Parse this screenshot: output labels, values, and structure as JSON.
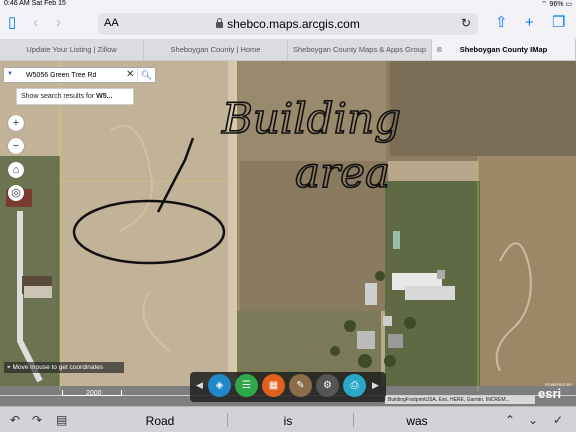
{
  "status": {
    "time": "0:46 AM",
    "date": "Sat Feb 15",
    "battery": "96%"
  },
  "browser": {
    "aa": "AA",
    "url": "shebco.maps.arcgis.com",
    "tabs": [
      {
        "label": "Update Your Listing | Zillow"
      },
      {
        "label": "Sheboygan County | Home"
      },
      {
        "label": "Sheboygan County Maps & Apps Group"
      },
      {
        "label": "Sheboygan County IMap"
      }
    ],
    "icons": [
      "sidebar-icon",
      "back-icon",
      "forward-icon",
      "reload-icon",
      "share-icon",
      "new-tab-icon",
      "tabs-icon"
    ]
  },
  "map": {
    "search": {
      "value": "W5056 Green Tree Rd",
      "suggestion_prefix": "Show search results for ",
      "suggestion_bold": "W5..."
    },
    "coords_text": "Move mouse to get coordinates",
    "road_label": "2000",
    "attribution": "BuildingFootprintUSA, Esri, HERE, Garmin, INCREM...",
    "powered_by": "POWERED BY",
    "esri": "esri",
    "annotation_line1": "Building",
    "annotation_line2": "area"
  },
  "keyboard": {
    "suggestions": [
      "Road",
      "is",
      "was"
    ]
  },
  "colors": {
    "accent": "#007aff",
    "ink": "#111111"
  }
}
